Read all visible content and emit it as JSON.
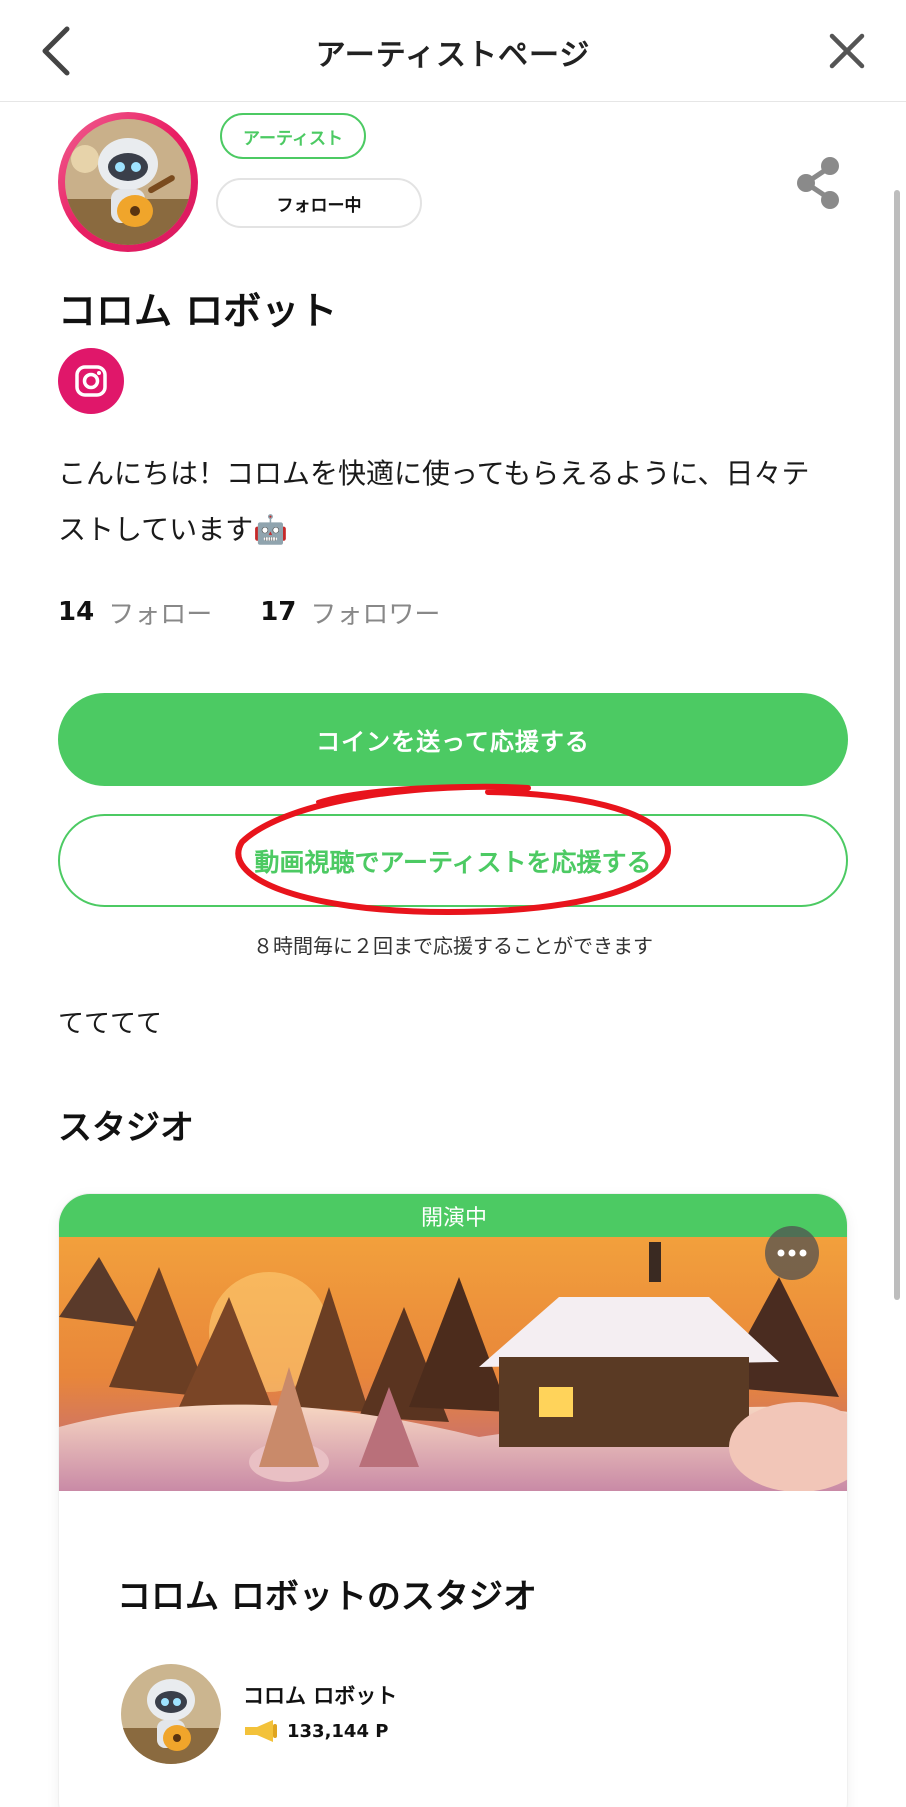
{
  "header": {
    "title": "アーティストページ"
  },
  "profile": {
    "badge": "アーティスト",
    "follow_label": "フォロー中",
    "name": "コロム ロボット",
    "bio_line1": "こんにちは！コロムを快適に使ってもらえるように、日々テ",
    "bio_line2": "ストしています🤖",
    "following_count": "14",
    "following_label": "フォロー",
    "follower_count": "17",
    "follower_label": "フォロワー"
  },
  "actions": {
    "coin_label": "コインを送って応援する",
    "video_label": "動画視聴でアーティストを応援する",
    "support_note": "８時間毎に２回まで応援することができます"
  },
  "extra_text": "てててて",
  "studio": {
    "section_title": "スタジオ",
    "status": "開演中",
    "name": "コロム ロボットのスタジオ",
    "owner_name": "コロム ロボット",
    "owner_points": "133,144 P"
  },
  "colors": {
    "accent": "#4cca63",
    "instagram": "#e0176a",
    "annotation": "#e8141c"
  },
  "icons": [
    "back-chevron-icon",
    "close-icon",
    "share-icon",
    "instagram-icon",
    "more-dots-icon",
    "megaphone-icon"
  ]
}
